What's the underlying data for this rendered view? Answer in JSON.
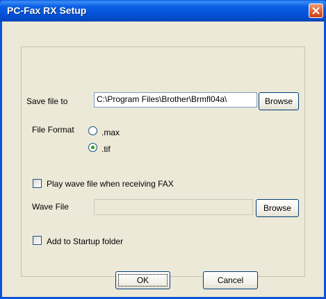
{
  "window": {
    "title": "PC-Fax RX Setup"
  },
  "save_file": {
    "label": "Save file to",
    "path": "C:\\Program Files\\Brother\\Brmfl04a\\",
    "browse_label": "Browse"
  },
  "file_format": {
    "label": "File Format",
    "options": [
      {
        "label": ".max",
        "checked": false
      },
      {
        "label": ".tif",
        "checked": true
      }
    ]
  },
  "play_wave": {
    "label": "Play wave file when receiving FAX",
    "checked": false
  },
  "wave_file": {
    "label": "Wave File",
    "value": "",
    "browse_label": "Browse"
  },
  "startup": {
    "label": "Add to Startup folder",
    "checked": false
  },
  "footer": {
    "ok_label": "OK",
    "cancel_label": "Cancel"
  }
}
